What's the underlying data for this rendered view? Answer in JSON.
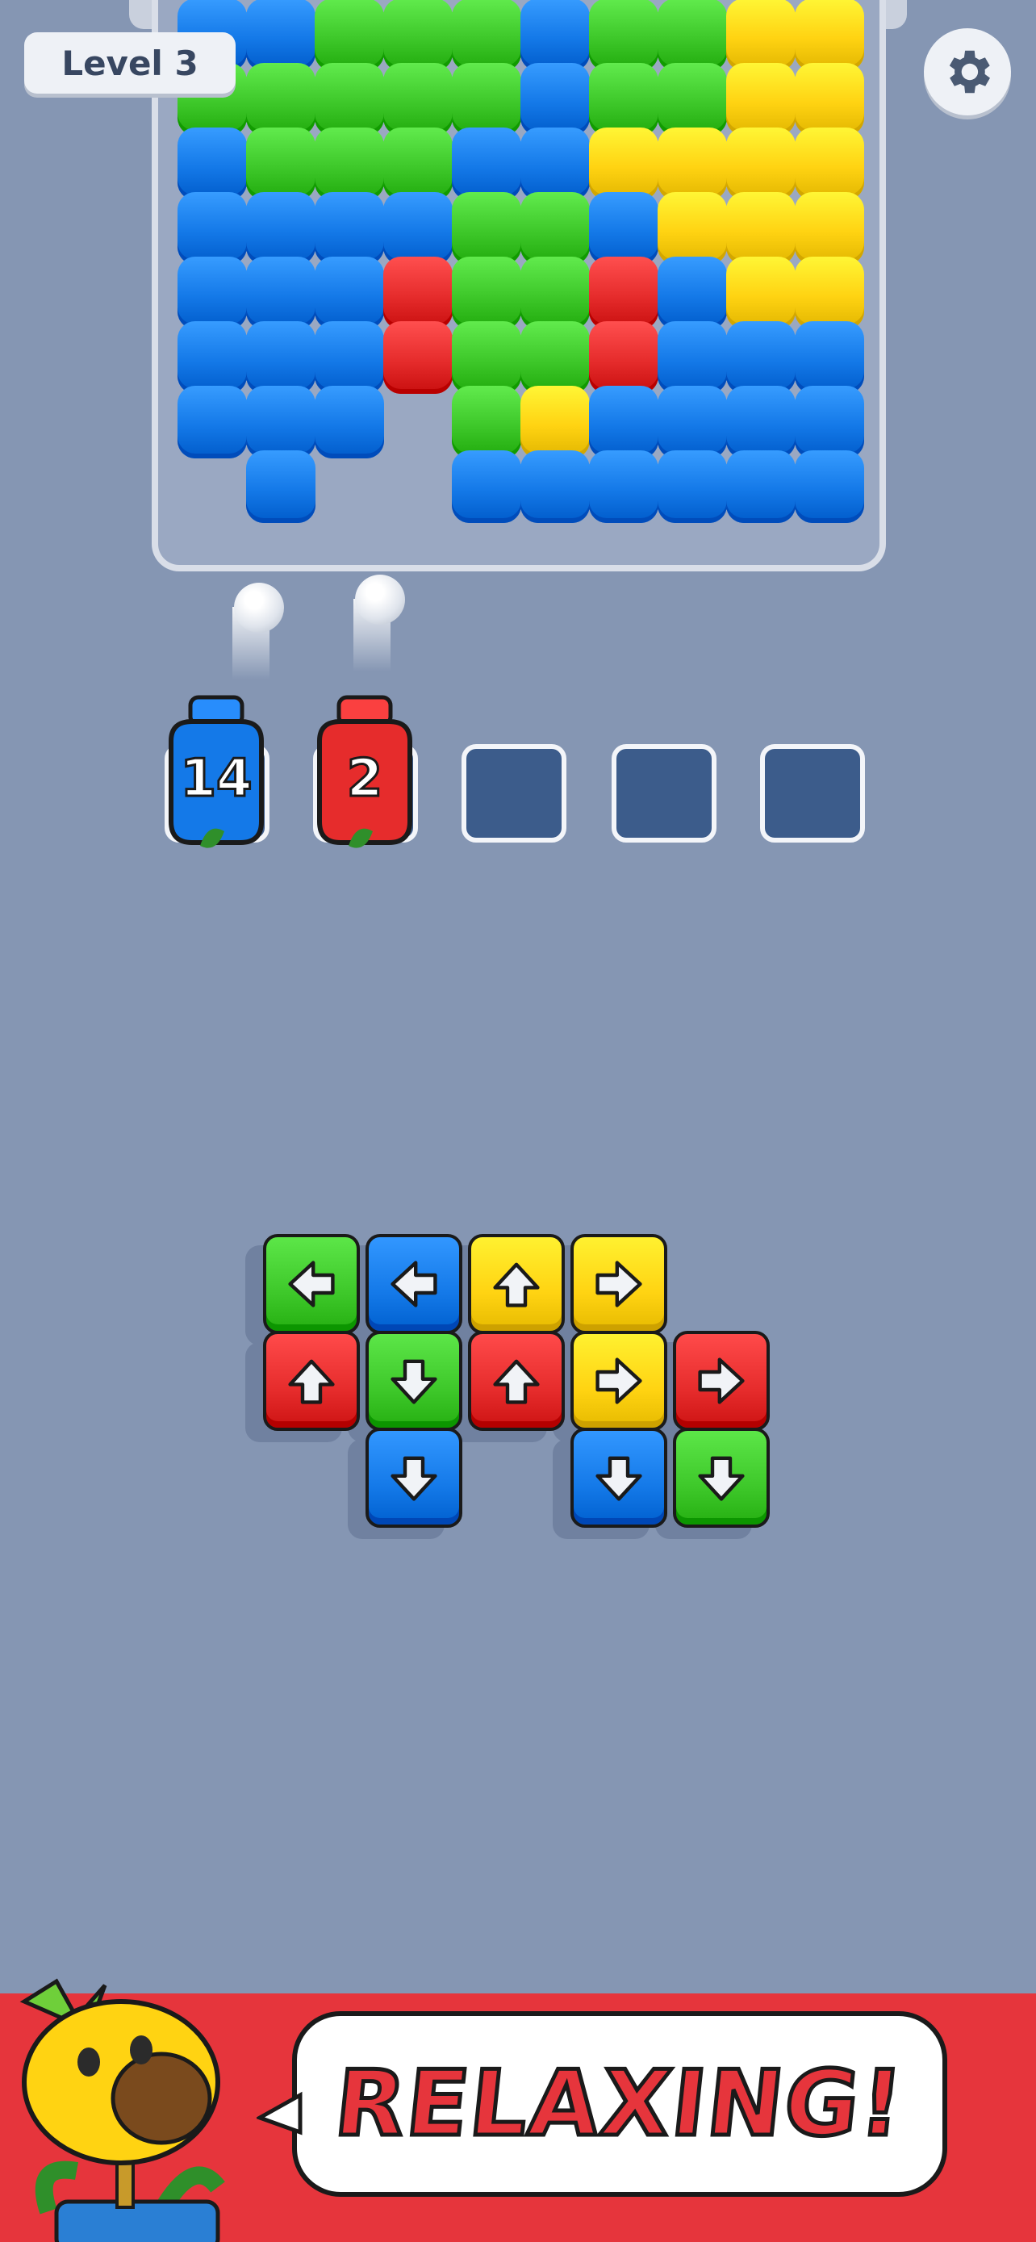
{
  "header": {
    "level_label": "Level 3"
  },
  "board": {
    "columns": 10,
    "grid": [
      [
        "blue",
        "blue",
        "green",
        "green",
        "green",
        "blue",
        "green",
        "green",
        "yellow",
        "yellow"
      ],
      [
        "green",
        "green",
        "green",
        "green",
        "green",
        "blue",
        "green",
        "green",
        "yellow",
        "yellow"
      ],
      [
        "blue",
        "green",
        "green",
        "green",
        "blue",
        "blue",
        "yellow",
        "yellow",
        "yellow",
        "yellow"
      ],
      [
        "blue",
        "blue",
        "blue",
        "blue",
        "green",
        "green",
        "blue",
        "yellow",
        "yellow",
        "yellow"
      ],
      [
        "blue",
        "blue",
        "blue",
        "red",
        "green",
        "green",
        "red",
        "blue",
        "yellow",
        "yellow"
      ],
      [
        "blue",
        "blue",
        "blue",
        "red",
        "green",
        "green",
        "red",
        "blue",
        "blue",
        "blue"
      ],
      [
        "blue",
        "blue",
        "blue",
        "",
        "green",
        "yellow",
        "blue",
        "blue",
        "blue",
        "blue"
      ],
      [
        "",
        "blue",
        "",
        "",
        "blue",
        "blue",
        "blue",
        "blue",
        "blue",
        "blue"
      ]
    ]
  },
  "shooters": [
    {
      "color": "blue",
      "count": "14"
    },
    {
      "color": "red",
      "count": "2"
    }
  ],
  "empty_slots": 3,
  "arrow_tiles": [
    {
      "color": "green",
      "direction": "left",
      "row": 0,
      "col": 0
    },
    {
      "color": "blue",
      "direction": "left",
      "row": 0,
      "col": 1
    },
    {
      "color": "yellow",
      "direction": "up",
      "row": 0,
      "col": 2
    },
    {
      "color": "yellow",
      "direction": "right",
      "row": 0,
      "col": 3
    },
    {
      "color": "red",
      "direction": "up",
      "row": 1,
      "col": 0
    },
    {
      "color": "green",
      "direction": "down",
      "row": 1,
      "col": 1
    },
    {
      "color": "red",
      "direction": "up",
      "row": 1,
      "col": 2
    },
    {
      "color": "yellow",
      "direction": "right",
      "row": 1,
      "col": 3
    },
    {
      "color": "red",
      "direction": "right",
      "row": 1,
      "col": 4
    },
    {
      "color": "blue",
      "direction": "down",
      "row": 2,
      "col": 1
    },
    {
      "color": "blue",
      "direction": "down",
      "row": 2,
      "col": 3
    },
    {
      "color": "green",
      "direction": "down",
      "row": 2,
      "col": 4
    }
  ],
  "banner": {
    "text": "RELAXING!"
  },
  "colors": {
    "blue": "#1479e8",
    "green": "#3ec82a",
    "yellow": "#ffd312",
    "red": "#e62c2c",
    "background": "#8596b3",
    "slot": "#3c5c8b"
  }
}
